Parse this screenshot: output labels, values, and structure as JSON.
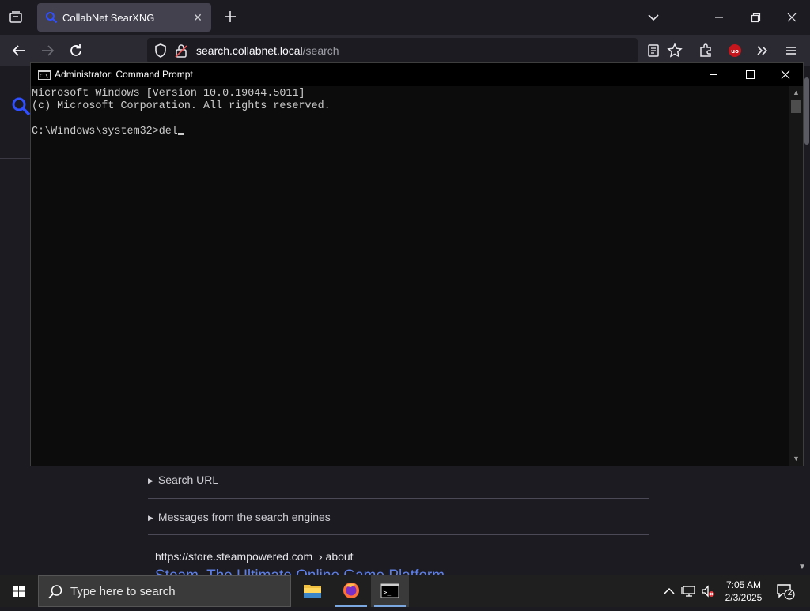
{
  "browser": {
    "tab_title": "CollabNet SearXNG",
    "url_host": "search.collabnet.local",
    "url_path": "/search"
  },
  "page": {
    "details": [
      {
        "label": "Search URL"
      },
      {
        "label": "Messages from the search engines"
      }
    ],
    "result": {
      "url": "https://store.steampowered.com",
      "breadcrumb": "› about",
      "title": "Steam, The Ultimate Online Game Platform"
    }
  },
  "cmd": {
    "title": "Administrator: Command Prompt",
    "lines": [
      "Microsoft Windows [Version 10.0.19044.5011]",
      "(c) Microsoft Corporation. All rights reserved.",
      "",
      "C:\\Windows\\system32>del"
    ]
  },
  "taskbar": {
    "search_placeholder": "Type here to search",
    "time": "7:05 AM",
    "date": "2/3/2025",
    "notification_count": "2"
  },
  "colors": {
    "accent_link": "#5d7fe6",
    "taskbar_active": "#7aa7e0",
    "ublock_red": "#c4161c"
  }
}
